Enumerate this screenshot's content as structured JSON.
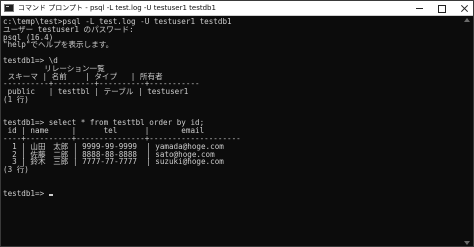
{
  "window": {
    "title": "コマンド プロンプト - psql  -L test.log -U testuser1 testdb1",
    "icon": "console-icon"
  },
  "console": {
    "lines": [
      "c:\\temp\\test>psql -L test.log -U testuser1 testdb1",
      "ユーザー testuser1 のパスワード:",
      "psql (16.4)",
      "\"help\"でヘルプを表示します。",
      "",
      "testdb1=> \\d",
      "         リレーション一覧",
      " スキーマ | 名前    | タイプ   | 所有者",
      "----------+---------+----------+-----------",
      " public   | testtbl | テーブル | testuser1",
      "(1 行)",
      "",
      "",
      "testdb1=> select * from testtbl order by id;",
      " id | name     |      tel      |       email",
      "----+----------+---------------+--------------------",
      "  1 | 山田　太郎 | 9999-99-9999  | yamada@hoge.com",
      "  2 | 佐藤　二郎 | 8888-88-8888  | sato@hoge.com",
      "  3 | 鈴木　三郎 | 7777-77-7777  | suzuki@hoge.com",
      "(3 行)",
      "",
      "",
      "testdb1=> "
    ]
  }
}
